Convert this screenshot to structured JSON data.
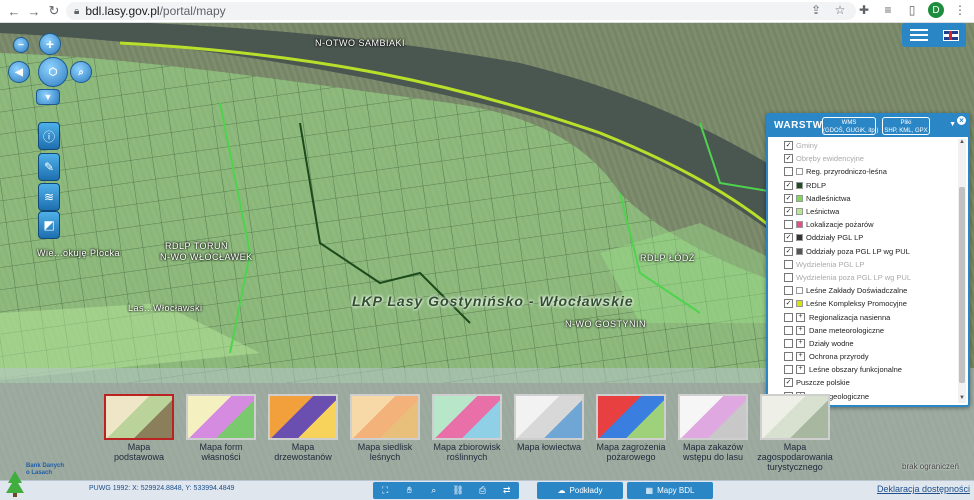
{
  "browser": {
    "url_domain": "bdl.lasy.gov.pl",
    "url_path": "/portal/mapy",
    "avatar_letter": "D"
  },
  "map": {
    "labels": {
      "narew": "N-OTWO SAMBIAKI",
      "rdlp_torun": "RDLP TORUŃ",
      "n_wloclawek": "N-WO WŁOCŁAWEK",
      "wiele": "Wie...okuję Plocka",
      "gostynin": "N-WO GOSTYNIN",
      "wloclawek": "Las...Włocławski",
      "lkp": "LKP Lasy Gostynińsko - Włocławskie",
      "orle": "RDLP ŁÓDŹ"
    }
  },
  "menu": {
    "icons": [
      "menu-icon",
      "uk-flag-icon"
    ]
  },
  "layers_panel": {
    "title": "WARSTWY",
    "wms_button": "WMS\n(GDOŚ, GUGiK, itp.)",
    "files_button": "Pliki\nSHP, KML, GPX",
    "items": [
      {
        "label": "Gminy",
        "checked": true,
        "disabled": true,
        "swatch": "none",
        "type": "check"
      },
      {
        "label": "Obręby ewidencyjne",
        "checked": true,
        "disabled": true,
        "swatch": "none",
        "type": "check"
      },
      {
        "label": "Reg. przyrodniczo-leśna",
        "checked": false,
        "disabled": false,
        "swatch": "#ffffff",
        "type": "check"
      },
      {
        "label": "RDLP",
        "checked": true,
        "disabled": false,
        "swatch": "#1f4f1f",
        "type": "check"
      },
      {
        "label": "Nadleśnictwa",
        "checked": true,
        "disabled": false,
        "swatch": "#7ed957",
        "type": "check"
      },
      {
        "label": "Leśnictwa",
        "checked": true,
        "disabled": false,
        "swatch": "#b6e88f",
        "type": "check"
      },
      {
        "label": "Lokalizacje pożarów",
        "checked": false,
        "disabled": false,
        "swatch": "#e94b8f",
        "type": "check"
      },
      {
        "label": "Oddziały PGL LP",
        "checked": true,
        "disabled": false,
        "swatch": "#333333",
        "type": "check"
      },
      {
        "label": "Oddziały poza PGL LP wg PUL",
        "checked": true,
        "disabled": false,
        "swatch": "#555555",
        "type": "check"
      },
      {
        "label": "Wydzielenia PGL LP",
        "checked": false,
        "disabled": true,
        "swatch": "none",
        "type": "check"
      },
      {
        "label": "Wydzielenia poza PGL LP wg PUL",
        "checked": false,
        "disabled": true,
        "swatch": "none",
        "type": "check"
      },
      {
        "label": "Leśne Zakłady Doświadczalne",
        "checked": false,
        "disabled": false,
        "swatch": "#ffffff",
        "type": "check"
      },
      {
        "label": "Leśne Kompleksy Promocyjne",
        "checked": true,
        "disabled": false,
        "swatch": "#d4e600",
        "type": "check"
      },
      {
        "label": "Regionalizacja nasienna",
        "checked": false,
        "disabled": false,
        "swatch": "none",
        "type": "group"
      },
      {
        "label": "Dane meteorologiczne",
        "checked": false,
        "disabled": false,
        "swatch": "none",
        "type": "group"
      },
      {
        "label": "Działy wodne",
        "checked": false,
        "disabled": false,
        "swatch": "none",
        "type": "group"
      },
      {
        "label": "Ochrona przyrody",
        "checked": false,
        "disabled": false,
        "swatch": "none",
        "type": "group"
      },
      {
        "label": "Leśne obszary funkcjonalne",
        "checked": false,
        "disabled": false,
        "swatch": "none",
        "type": "group"
      },
      {
        "label": "Puszcze polskie",
        "checked": true,
        "disabled": false,
        "swatch": "none",
        "type": "check"
      },
      {
        "label": "Dane geologiczne",
        "checked": false,
        "disabled": false,
        "swatch": "none",
        "type": "group"
      }
    ]
  },
  "basemaps": [
    {
      "label": "Mapa\npodstawowa",
      "selected": true,
      "colors": [
        "#efe6c8",
        "#b9d39a",
        "#8a7f5a"
      ]
    },
    {
      "label": "Mapa form\nwłasności",
      "selected": false,
      "colors": [
        "#f4f0c0",
        "#d48be0",
        "#7bc96f"
      ]
    },
    {
      "label": "Mapa\ndrzewostanów",
      "selected": false,
      "colors": [
        "#f2a03c",
        "#6a4fb0",
        "#f7d35c"
      ]
    },
    {
      "label": "Mapa siedlisk\nleśnych",
      "selected": false,
      "colors": [
        "#f7d9a8",
        "#f2b27a",
        "#e8c07c"
      ]
    },
    {
      "label": "Mapa zbiorowisk\nroślinnych",
      "selected": false,
      "colors": [
        "#b8e6c8",
        "#e86fa8",
        "#8fd0e6"
      ]
    },
    {
      "label": "Mapa łowiectwa",
      "selected": false,
      "colors": [
        "#f2f2f2",
        "#d8d8d8",
        "#6fa6d6"
      ]
    },
    {
      "label": "Mapa zagrożenia\npożarowego",
      "selected": false,
      "colors": [
        "#e84040",
        "#3a7fe0",
        "#9fd07a"
      ]
    },
    {
      "label": "Mapa zakazów\nwstępu do lasu",
      "selected": false,
      "colors": [
        "#f6f6f6",
        "#e0a8e0",
        "#c8c8c8"
      ]
    },
    {
      "label": "Mapa\nzagospodarowania\nturystycznego",
      "selected": false,
      "colors": [
        "#eef0e8",
        "#d8e0d0",
        "#a8b8a0"
      ]
    }
  ],
  "footer": {
    "logo_text": "Bank Danych\no Lasach",
    "coords": "PUWG 1992: X: 529924.8848, Y: 533994.4849",
    "podklady": "Podkłady",
    "mapy_bdl": "Mapy BDL",
    "accessibility": "Deklaracja dostępności",
    "scale": "brak ograniczeń"
  }
}
